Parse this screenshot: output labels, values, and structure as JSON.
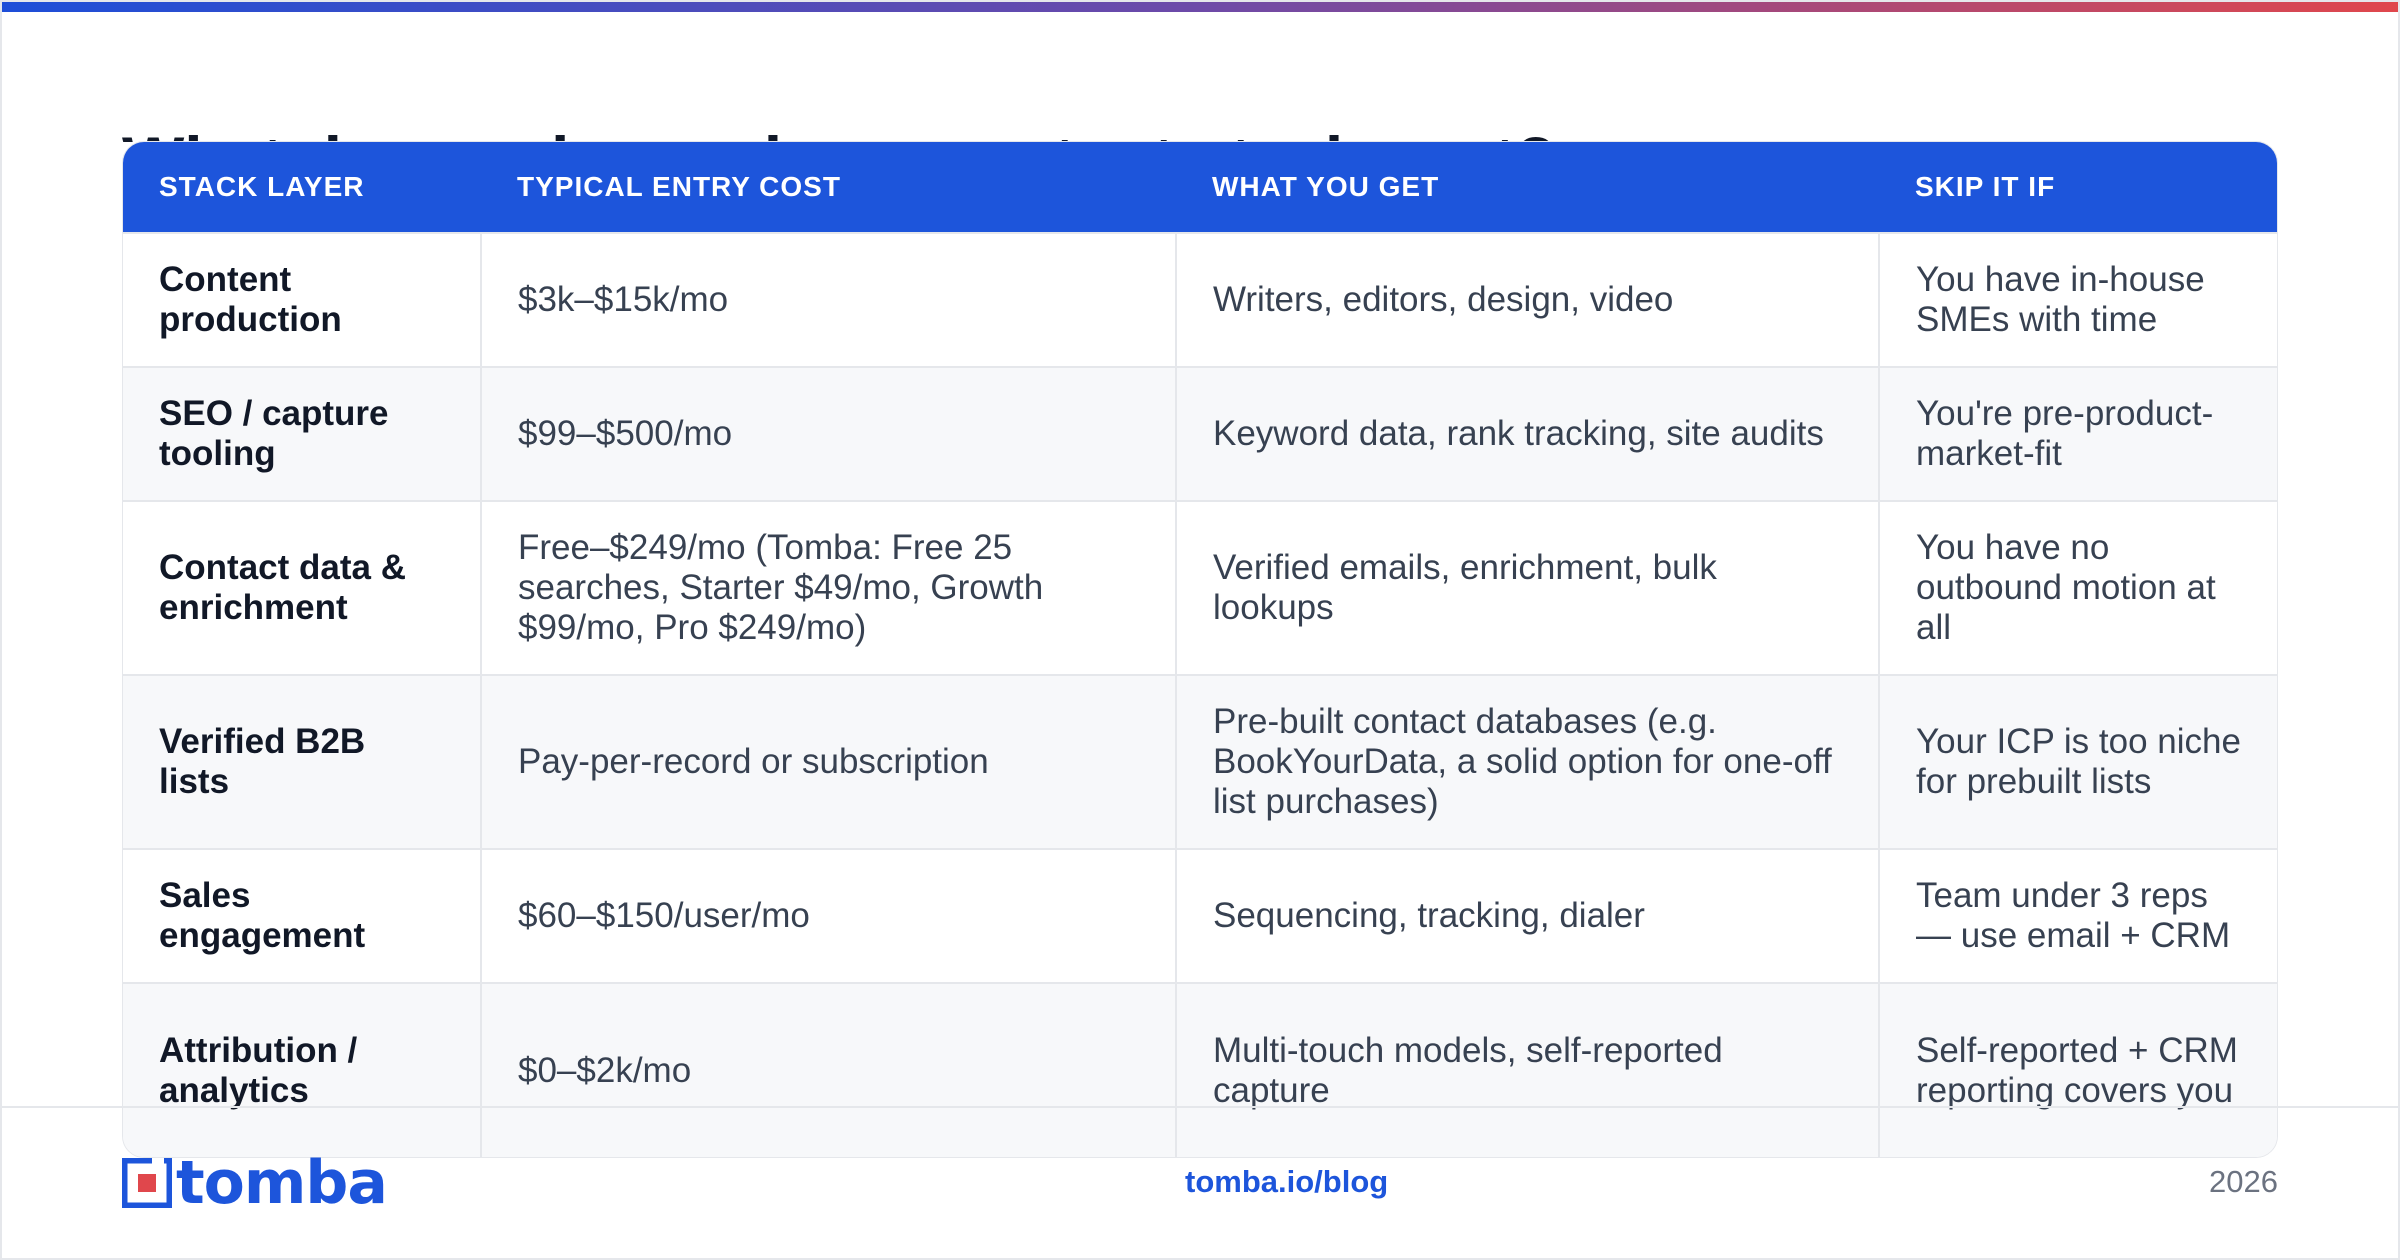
{
  "page": {
    "title": "What does a demand gen content stack cost?",
    "brand_color": "#1d55db"
  },
  "table": {
    "headers": [
      "STACK LAYER",
      "TYPICAL ENTRY COST",
      "WHAT YOU GET",
      "SKIP IT IF"
    ],
    "rows": [
      {
        "layer": "Content production",
        "cost": "$3k–$15k/mo",
        "get": "Writers, editors, design, video",
        "skip": "You have in-house SMEs with time"
      },
      {
        "layer": "SEO / capture tooling",
        "cost": "$99–$500/mo",
        "get": "Keyword data, rank tracking, site audits",
        "skip": "You're pre-product-market-fit"
      },
      {
        "layer": "Contact data & enrichment",
        "cost": "Free–$249/mo (Tomba: Free 25 searches, Starter $49/mo, Growth $99/mo, Pro $249/mo)",
        "get": "Verified emails, enrichment, bulk lookups",
        "skip": "You have no outbound motion at all"
      },
      {
        "layer": "Verified B2B lists",
        "cost": "Pay-per-record or subscription",
        "get": "Pre-built contact databases (e.g. BookYourData, a solid option for one-off list purchases)",
        "skip": "Your ICP is too niche for prebuilt lists"
      },
      {
        "layer": "Sales engagement",
        "cost": "$60–$150/user/mo",
        "get": "Sequencing, tracking, dialer",
        "skip": "Team under 3 reps — use email + CRM"
      },
      {
        "layer": "Attribution / analytics",
        "cost": "$0–$2k/mo",
        "get": "Multi-touch models, self-reported capture",
        "skip": "Self-reported + CRM reporting covers you"
      }
    ]
  },
  "footer": {
    "logo_text": "tomba",
    "url": "tomba.io/blog",
    "year": "2026"
  }
}
